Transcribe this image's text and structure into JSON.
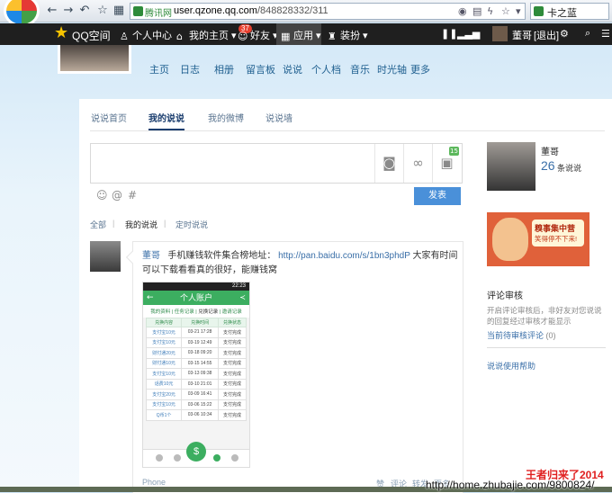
{
  "browser": {
    "address_tag": "腾讯网",
    "url_host": "user.qzone.qq.com",
    "url_path": "/848828332/311",
    "search_text": "卡之蓝",
    "nav_icons": [
      "back-arrow",
      "forward-arrow",
      "undo",
      "star",
      "grid"
    ]
  },
  "qzone_bar": {
    "brand": "QQ空间",
    "items": [
      "个人中心",
      "我的主页",
      "好友",
      "应用",
      "装扮"
    ],
    "friends_badge": "37",
    "user_name": "董哥",
    "logout": "[退出]"
  },
  "main_nav": [
    "主页",
    "日志",
    "相册",
    "留言板",
    "说说",
    "个人档",
    "音乐",
    "时光轴",
    "更多"
  ],
  "tabs": [
    "说说首页",
    "我的说说",
    "我的微博",
    "说说墙"
  ],
  "active_tab": "我的说说",
  "editor": {
    "tool_badge": "15",
    "post_button": "发表"
  },
  "sub_tabs": [
    "全部",
    "我的说说",
    "定时说说"
  ],
  "post": {
    "author": "董哥",
    "text_before": "手机赚钱软件集合榜地址：",
    "link": "http://pan.baidu.com/s/1bn3phdP",
    "text_after": "大家有时间可以下载看看真的很好，能赚钱窝",
    "footer": [
      "Phone",
      "赞",
      "评论",
      "转发",
      "更多"
    ]
  },
  "phone": {
    "time": "22:23",
    "title": "个人账户",
    "links": [
      "我的资料",
      "任务记录",
      "兑换记录",
      "邀请记录"
    ],
    "current_link": "兑换记录",
    "columns": [
      "兑换内容",
      "兑换时间",
      "兑换状态"
    ],
    "rows": [
      [
        "支付宝10元",
        "03-21 17:28",
        "支付完成"
      ],
      [
        "支付宝10元",
        "03-19 12:49",
        "支付完成"
      ],
      [
        "财付通20元",
        "03-18 09:20",
        "支付完成"
      ],
      [
        "财付通10元",
        "03-15 14:55",
        "支付完成"
      ],
      [
        "支付宝10元",
        "03-13 09:38",
        "支付完成"
      ],
      [
        "话费10元",
        "03-10 21:01",
        "支付完成"
      ],
      [
        "支付宝20元",
        "03-09 16:41",
        "支付完成"
      ],
      [
        "支付宝10元",
        "03-06 15:22",
        "支付完成"
      ],
      [
        "Q币1个",
        "03-06 10:34",
        "支付完成"
      ]
    ]
  },
  "sidebar": {
    "name": "董哥",
    "count": "26",
    "count_label": "条说说",
    "ad_line1": "糗事集中营",
    "ad_line2": "笑得停不下来!",
    "review_title": "评论审核",
    "review_desc": "开启评论审核后，非好友对您说说的回复经过审核才能显示",
    "pending_label": "当前待审核评论",
    "pending_count": "(0)",
    "help": "说说使用帮助"
  },
  "watermark": {
    "line1": "王者归来了2014",
    "line2": "http://home.zhubajie.com/9800824/"
  },
  "colors": {
    "link": "#3a6fa8",
    "post_button": "#4a90d9",
    "phone_green": "#3cae60",
    "watermark_red": "#e02020"
  }
}
